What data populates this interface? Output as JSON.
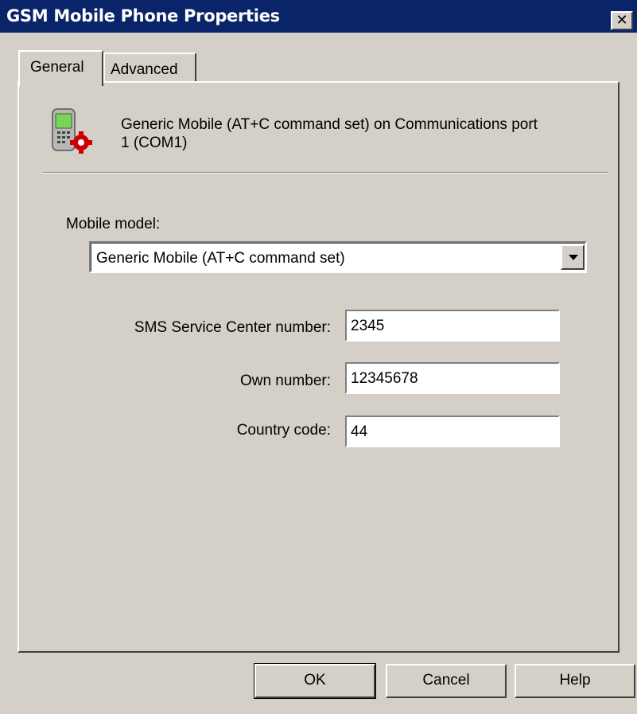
{
  "window": {
    "title": "GSM Mobile Phone Properties",
    "close_glyph": "✕"
  },
  "tabs": [
    {
      "label": "General",
      "selected": true
    },
    {
      "label": "Advanced",
      "selected": false
    }
  ],
  "device": {
    "icon": "mobile-phone-gear-icon",
    "name": "Generic Mobile (AT+C command set) on Communications port\n1 (COM1)"
  },
  "form": {
    "model_label": "Mobile model:",
    "model_value": "Generic Mobile (AT+C command set)",
    "sms_label": "SMS Service Center number:",
    "sms_value": "2345",
    "own_label": "Own number:",
    "own_value": "12345678",
    "country_label": "Country code:",
    "country_value": "44"
  },
  "buttons": {
    "ok": "OK",
    "cancel": "Cancel",
    "help": "Help"
  },
  "colors": {
    "titlebar": "#0a246a",
    "face": "#d4d0c8",
    "icon_gear": "#cc0000",
    "icon_screen": "#7bd35a"
  }
}
